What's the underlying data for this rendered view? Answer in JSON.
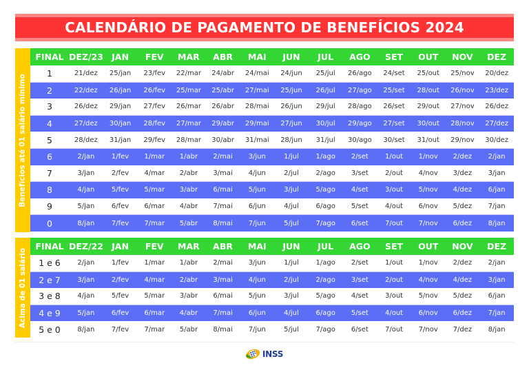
{
  "title": "CALENDÁRIO DE PAGAMENTO DE BENEFÍCIOS 2024",
  "colors": {
    "title_bg": "#ff3333",
    "header_bg": "#33d633",
    "alt_row_bg": "#5b6ef5",
    "side_label_bg": "#ffcc00"
  },
  "tables": [
    {
      "side_label": "Benefícios até 01 salário mínimo",
      "headers": [
        "FINAL",
        "DEZ/23",
        "JAN",
        "FEV",
        "MAR",
        "ABR",
        "MAI",
        "JUN",
        "JUL",
        "AGO",
        "SET",
        "OUT",
        "NOV",
        "DEZ"
      ],
      "rows": [
        [
          "1",
          "21/dez",
          "25/jan",
          "23/fev",
          "22/mar",
          "24/abr",
          "24/mai",
          "24/jun",
          "25/jul",
          "26/ago",
          "24/set",
          "25/out",
          "25/nov",
          "20/dez"
        ],
        [
          "2",
          "22/dez",
          "26/jan",
          "26/fev",
          "25/mar",
          "25/abr",
          "27/mai",
          "25/jun",
          "26/jul",
          "27/ago",
          "25/set",
          "28/out",
          "26/nov",
          "23/dez"
        ],
        [
          "3",
          "26/dez",
          "29/jan",
          "27/fev",
          "26/mar",
          "26/abr",
          "28/mai",
          "26/jun",
          "29/jul",
          "28/ago",
          "26/set",
          "29/out",
          "27/nov",
          "26/dez"
        ],
        [
          "4",
          "27/dez",
          "30/jan",
          "28/fev",
          "27/mar",
          "29/abr",
          "29/mai",
          "27/jun",
          "30/jul",
          "29/ago",
          "27/set",
          "30/out",
          "28/nov",
          "27/dez"
        ],
        [
          "5",
          "28/dez",
          "31/jan",
          "29/fev",
          "28/mar",
          "30/abr",
          "31/mai",
          "28/jun",
          "31/jul",
          "30/ago",
          "30/set",
          "31/out",
          "29/nov",
          "30/dez"
        ],
        [
          "6",
          "2/jan",
          "1/fev",
          "1/mar",
          "1/abr",
          "2/mai",
          "3/jun",
          "1/jul",
          "1/ago",
          "2/set",
          "1/out",
          "1/nov",
          "2/dez",
          "2/jan"
        ],
        [
          "7",
          "3/jan",
          "2/fev",
          "4/mar",
          "2/abr",
          "3/mai",
          "4/jun",
          "2/jul",
          "2/ago",
          "3/set",
          "2/out",
          "4/nov",
          "3/dez",
          "3/jan"
        ],
        [
          "8",
          "4/jan",
          "5/fev",
          "5/mar",
          "3/abr",
          "6/mai",
          "5/jun",
          "3/jul",
          "5/ago",
          "4/set",
          "3/out",
          "5/nov",
          "4/dez",
          "6/jan"
        ],
        [
          "9",
          "5/jan",
          "6/fev",
          "6/mar",
          "4/abr",
          "7/mai",
          "6/jun",
          "4/jul",
          "6/ago",
          "5/set",
          "4/out",
          "6/nov",
          "5/dez",
          "7/jan"
        ],
        [
          "0",
          "8/jan",
          "7/fev",
          "7/mar",
          "5/abr",
          "8/mai",
          "7/jun",
          "5/jul",
          "7/ago",
          "6/set",
          "7/out",
          "7/nov",
          "6/dez",
          "8/jan"
        ]
      ]
    },
    {
      "side_label": "Acima de 01 salário",
      "headers": [
        "FINAL",
        "DEZ/22",
        "JAN",
        "FEV",
        "MAR",
        "ABR",
        "MAI",
        "JUN",
        "JUL",
        "AGO",
        "SET",
        "OUT",
        "NOV",
        "DEZ"
      ],
      "rows": [
        [
          "1 e 6",
          "2/jan",
          "1/fev",
          "1/mar",
          "1/abr",
          "2/mai",
          "3/jun",
          "1/jul",
          "1/ago",
          "2/set",
          "1/out",
          "1/nov",
          "2/dez",
          "2/jan"
        ],
        [
          "2 e 7",
          "3/jan",
          "2/fev",
          "4/mar",
          "2/abr",
          "3/mai",
          "4/jun",
          "2/jul",
          "2/ago",
          "3/set",
          "2/out",
          "4/nov",
          "4/dez",
          "3/jan"
        ],
        [
          "3 e 8",
          "4/jan",
          "5/fev",
          "5/mar",
          "3/abr",
          "6/mai",
          "5/jun",
          "3/jul",
          "5/ago",
          "4/set",
          "3/out",
          "5/nov",
          "5/dez",
          "6/jan"
        ],
        [
          "4 e 9",
          "5/jan",
          "6/fev",
          "6/mar",
          "4/abr",
          "7/mai",
          "6/jun",
          "4/jul",
          "6/ago",
          "5/set",
          "4/out",
          "6/nov",
          "6/dez",
          "7/jan"
        ],
        [
          "5 e 0",
          "8/jan",
          "7/fev",
          "7/mar",
          "5/abr",
          "8/mai",
          "7/jun",
          "5/jul",
          "7/ago",
          "6/set",
          "7/out",
          "7/nov",
          "7/dez",
          "8/jan"
        ]
      ]
    }
  ],
  "footer": {
    "logo_icon": "inss-logo-icon",
    "logo_text": "INSS"
  }
}
